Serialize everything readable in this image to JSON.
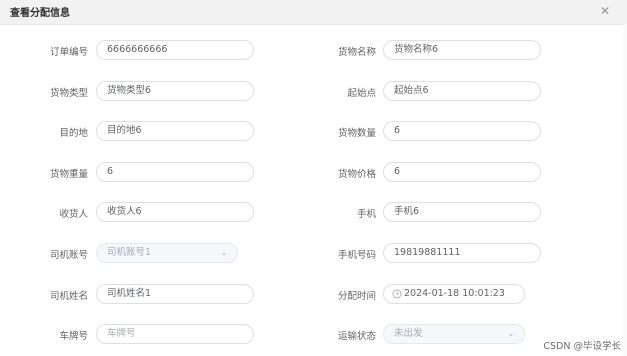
{
  "dialog": {
    "title": "查看分配信息",
    "close_icon": "close-icon"
  },
  "form": {
    "order_no": {
      "label": "订单编号",
      "value": "6666666666"
    },
    "goods_name": {
      "label": "货物名称",
      "value": "货物名称6"
    },
    "goods_type": {
      "label": "货物类型",
      "value": "货物类型6"
    },
    "origin": {
      "label": "起始点",
      "value": "起始点6"
    },
    "destination": {
      "label": "目的地",
      "value": "目的地6"
    },
    "goods_qty": {
      "label": "货物数量",
      "value": "6"
    },
    "goods_weight": {
      "label": "货物重量",
      "value": "6"
    },
    "goods_price": {
      "label": "货物价格",
      "value": "6"
    },
    "receiver": {
      "label": "收货人",
      "value": "收货人6"
    },
    "phone": {
      "label": "手机",
      "value": "手机6"
    },
    "driver_account": {
      "label": "司机账号",
      "value": "司机账号1"
    },
    "mobile": {
      "label": "手机号码",
      "value": "19819881111"
    },
    "driver_name": {
      "label": "司机姓名",
      "value": "司机姓名1"
    },
    "assign_time": {
      "label": "分配时间",
      "value": "2024-01-18 10:01:23"
    },
    "plate_no": {
      "label": "车牌号",
      "placeholder": "车牌号"
    },
    "transport_status": {
      "label": "运输状态",
      "placeholder": "未出发"
    }
  },
  "watermark": "CSDN @毕设学长"
}
